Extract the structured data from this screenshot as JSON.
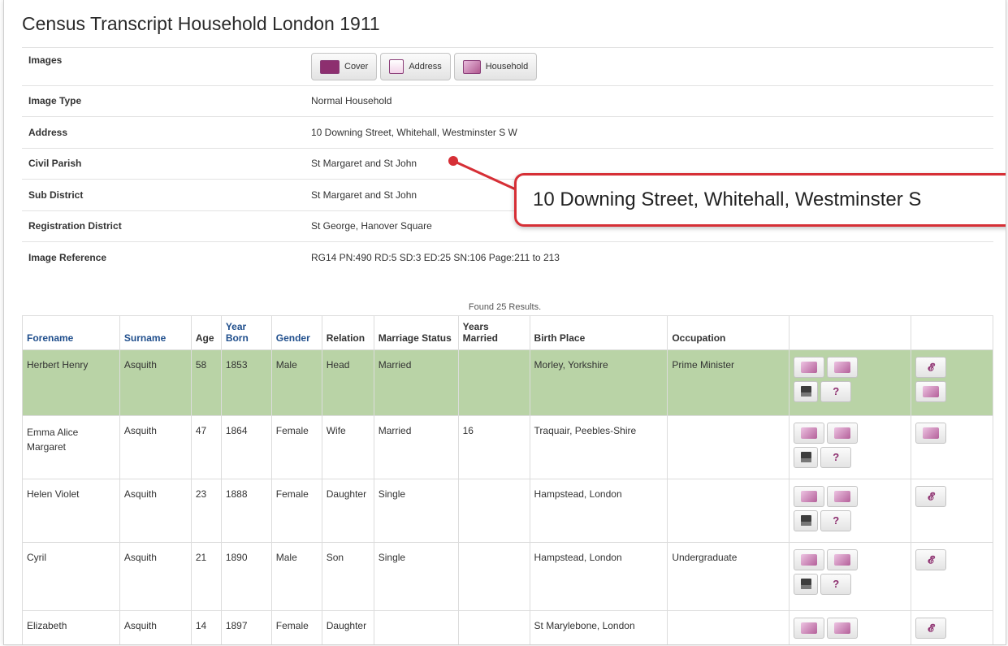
{
  "page": {
    "title": "Census Transcript Household London 1911"
  },
  "images": {
    "label": "Images",
    "buttons": [
      {
        "label": "Cover",
        "icon": "cover-icon"
      },
      {
        "label": "Address",
        "icon": "address-icon"
      },
      {
        "label": "Household",
        "icon": "household-icon"
      }
    ]
  },
  "details": [
    {
      "label": "Image Type",
      "value": "Normal Household"
    },
    {
      "label": "Address",
      "value": "10 Downing Street, Whitehall, Westminster S W"
    },
    {
      "label": "Civil Parish",
      "value": "St Margaret and St John"
    },
    {
      "label": "Sub District",
      "value": "St Margaret and St John"
    },
    {
      "label": "Registration District",
      "value": "St George, Hanover Square"
    },
    {
      "label": "Image Reference",
      "value": "RG14 PN:490 RD:5 SD:3 ED:25 SN:106 Page:211 to 213"
    }
  ],
  "callout": {
    "text": "10 Downing Street, Whitehall, Westminster S",
    "color": "#d62f36"
  },
  "results": {
    "found_text": "Found 25 Results.",
    "headers": [
      "Forename",
      "Surname",
      "Age",
      "Year Born",
      "Gender",
      "Relation",
      "Marriage Status",
      "Years Married",
      "Birth Place",
      "Occupation",
      "",
      ""
    ],
    "rows": [
      {
        "forename": "Herbert Henry",
        "surname": "Asquith",
        "age": "58",
        "born": "1853",
        "gender": "Male",
        "relation": "Head",
        "status": "Married",
        "years": "",
        "birthplace": "Morley, Yorkshire",
        "occupation": "Prime Minister",
        "highlight": true
      },
      {
        "forename": "Emma Alice Margaret",
        "surname": "Asquith",
        "age": "47",
        "born": "1864",
        "gender": "Female",
        "relation": "Wife",
        "status": "Married",
        "years": "16",
        "birthplace": "Traquair, Peebles-Shire",
        "occupation": "",
        "highlight": false
      },
      {
        "forename": "Helen Violet",
        "surname": "Asquith",
        "age": "23",
        "born": "1888",
        "gender": "Female",
        "relation": "Daughter",
        "status": "Single",
        "years": "",
        "birthplace": "Hampstead, London",
        "occupation": "",
        "highlight": false
      },
      {
        "forename": "Cyril",
        "surname": "Asquith",
        "age": "21",
        "born": "1890",
        "gender": "Male",
        "relation": "Son",
        "status": "Single",
        "years": "",
        "birthplace": "Hampstead, London",
        "occupation": "Undergraduate",
        "highlight": false
      },
      {
        "forename": "Elizabeth",
        "surname": "Asquith",
        "age": "14",
        "born": "1897",
        "gender": "Female",
        "relation": "Daughter",
        "status": "",
        "years": "",
        "birthplace": "St Marylebone, London",
        "occupation": "",
        "highlight": false
      }
    ]
  },
  "colors": {
    "highlight_row": "#b9d3a6",
    "link": "#1f4e8c",
    "icon_accent": "#8d2f6f"
  }
}
